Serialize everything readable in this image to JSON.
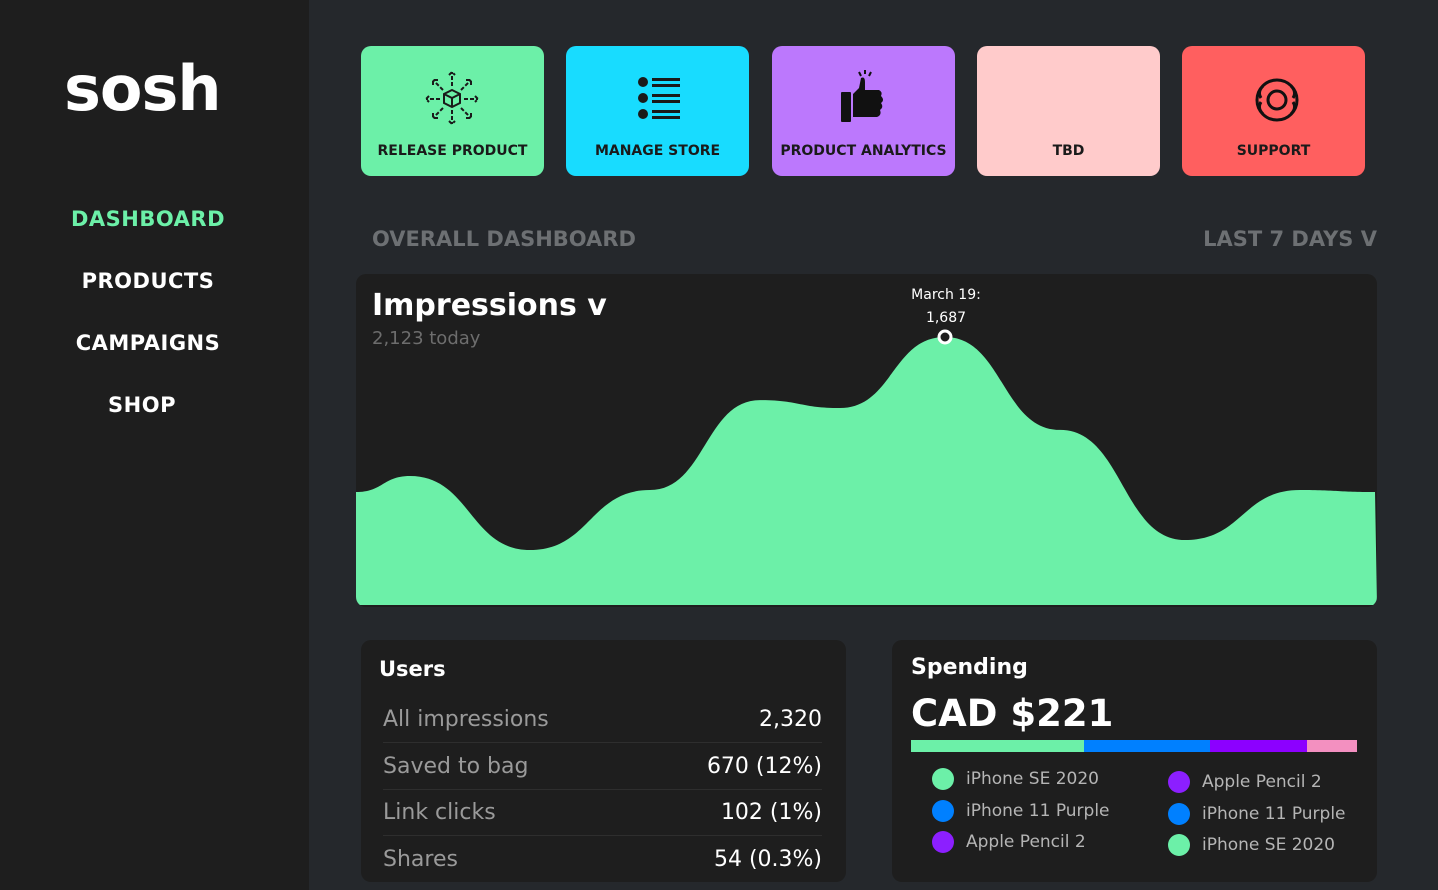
{
  "logo": "sosh",
  "nav": [
    {
      "label": "DASHBOARD",
      "active": true
    },
    {
      "label": "PRODUCTS"
    },
    {
      "label": "CAMPAIGNS"
    },
    {
      "label": "SHOP"
    }
  ],
  "actions": [
    {
      "label": "RELEASE PRODUCT",
      "icon": "box-expand-icon",
      "color": "#6cf0a8"
    },
    {
      "label": "MANAGE STORE",
      "icon": "list-icon",
      "color": "#18dcff"
    },
    {
      "label": "PRODUCT ANALYTICS",
      "icon": "thumbs-up-icon",
      "color": "#bc78fd"
    },
    {
      "label": "TBD",
      "icon": "",
      "color": "#ffcbcb"
    },
    {
      "label": "SUPPORT",
      "icon": "lifebuoy-icon",
      "color": "#ff5f5f"
    }
  ],
  "section_title": "OVERALL DASHBOARD",
  "range_select": "LAST 7 DAYS V",
  "impressions": {
    "title": "Impressions v",
    "subtitle": "2,123 today",
    "tooltip_date": "March 19:",
    "tooltip_value": "1,687"
  },
  "chart_data": {
    "type": "area",
    "values": [
      711,
      812,
      346,
      724,
      1290,
      1240,
      1687,
      1102,
      409,
      724,
      711
    ],
    "highlight": {
      "label": "March 19",
      "value": 1687,
      "index": 6
    },
    "color": "#6cf0a8",
    "grid": false,
    "axes": false
  },
  "users": {
    "title": "Users",
    "rows": [
      {
        "label": "All impressions",
        "value": "2,320"
      },
      {
        "label": "Saved to bag",
        "value": "670 (12%)"
      },
      {
        "label": "Link clicks",
        "value": "102 (1%)"
      },
      {
        "label": "Shares",
        "value": "54 (0.3%)"
      }
    ]
  },
  "spending": {
    "title": "Spending",
    "total": "CAD $221",
    "segments": [
      {
        "color": "#6cf0a8",
        "percent": 38.8
      },
      {
        "color": "#0080ff",
        "percent": 28.3
      },
      {
        "color": "#8c00ff",
        "percent": 21.7
      },
      {
        "color": "#f390c0",
        "percent": 11.2
      }
    ],
    "legend_left": [
      {
        "label": "iPhone SE 2020",
        "color": "#6cf0a8"
      },
      {
        "label": "iPhone 11 Purple",
        "color": "#0080ff"
      },
      {
        "label": "Apple Pencil 2",
        "color": "#8c1fff"
      }
    ],
    "legend_right": [
      {
        "label": "Apple Pencil 2",
        "color": "#8c1fff"
      },
      {
        "label": "iPhone 11 Purple",
        "color": "#0080ff"
      },
      {
        "label": "iPhone SE 2020",
        "color": "#6cf0a8"
      }
    ]
  }
}
